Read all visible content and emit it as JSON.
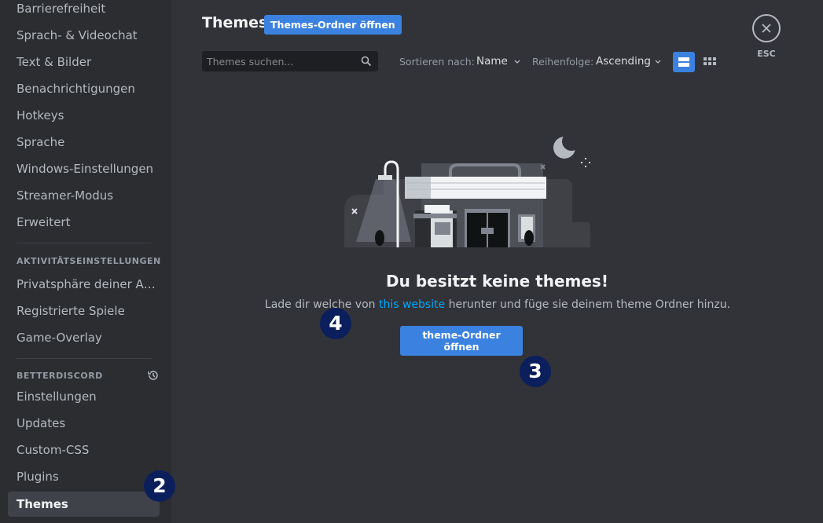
{
  "sidebar": {
    "items_top": [
      {
        "label": "Barrierefreiheit"
      },
      {
        "label": "Sprach- & Videochat"
      },
      {
        "label": "Text & Bilder"
      },
      {
        "label": "Benachrichtigungen"
      },
      {
        "label": "Hotkeys"
      },
      {
        "label": "Sprache"
      },
      {
        "label": "Windows-Einstellungen"
      },
      {
        "label": "Streamer-Modus"
      },
      {
        "label": "Erweitert"
      }
    ],
    "activity_header": "AKTIVITÄTSEINSTELLUNGEN",
    "activity_items": [
      {
        "label": "Privatsphäre deiner Ak..."
      },
      {
        "label": "Registrierte Spiele"
      },
      {
        "label": "Game-Overlay"
      }
    ],
    "bd_header": "BETTERDISCORD",
    "bd_items": [
      {
        "label": "Einstellungen"
      },
      {
        "label": "Updates"
      },
      {
        "label": "Custom-CSS"
      },
      {
        "label": "Plugins"
      },
      {
        "label": "Themes",
        "active": true
      }
    ]
  },
  "header": {
    "title": "Themes",
    "open_folder_label": "Themes-Ordner öffnen",
    "close_label": "ESC"
  },
  "toolbar": {
    "search_placeholder": "Themes suchen...",
    "sort_label": "Sortieren nach:",
    "sort_value": "Name",
    "order_label": "Reihenfolge:",
    "order_value": "Ascending",
    "view_mode": "list"
  },
  "empty": {
    "title": "Du besitzt keine themes!",
    "desc_before": "Lade dir welche von ",
    "link": "this website",
    "desc_after": " herunter und füge sie deinem theme Ordner hinzu.",
    "button_label": "theme-Ordner öffnen"
  },
  "annotations": {
    "two": "2",
    "three": "3",
    "four": "4"
  },
  "colors": {
    "accent": "#3b82e0",
    "link": "#00a8fc",
    "badge": "#0a1f5c"
  }
}
